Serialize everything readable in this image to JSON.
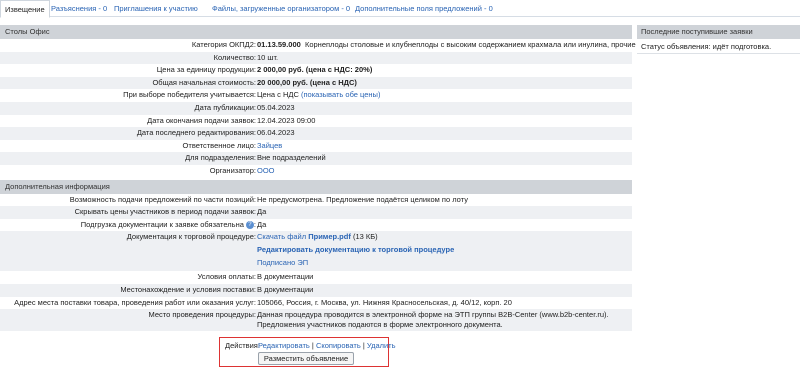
{
  "tabs": [
    {
      "label": "Извещение"
    },
    {
      "label": "Разъяснения - 0"
    },
    {
      "label": "Приглашения к участию"
    },
    {
      "label": "Файлы, загруженные организатором - 0"
    },
    {
      "label": "Дополнительные поля предложений - 0"
    }
  ],
  "main": {
    "section_title": "Столы Офис",
    "rows": [
      {
        "label": "Категория ОКПД2:",
        "code": "01.13.59.000",
        "value": "Корнеплоды столовые и клубнеплоды с высоким содержанием крахмала или инулина, прочие"
      },
      {
        "label": "Количество:",
        "value": "10 шт."
      },
      {
        "label": "Цена за единицу продукции:",
        "value": "2 000,00 руб. (цена с НДС: 20%)"
      },
      {
        "label": "Общая начальная стоимость:",
        "value": "20 000,00 руб. (цена с НДС)"
      },
      {
        "label": "При выборе победителя учитывается:",
        "value": "Цена с НДС",
        "link": "(показывать обе цены)"
      },
      {
        "label": "Дата публикации:",
        "value": "05.04.2023"
      },
      {
        "label": "Дата окончания подачи заявок:",
        "value": "12.04.2023 09:00"
      },
      {
        "label": "Дата последнего редактирования:",
        "value": "06.04.2023"
      },
      {
        "label": "Ответственное лицо:",
        "value": "Зайцев"
      },
      {
        "label": "Для подразделения:",
        "value": "Вне подразделений"
      },
      {
        "label": "Организатор:",
        "value": "ООО"
      }
    ]
  },
  "additional": {
    "section_title": "Дополнительная информация",
    "rows": [
      {
        "label": "Возможность подачи предложений по части позиций:",
        "value": "Не предусмотрена. Предложение подаётся целиком по лоту"
      },
      {
        "label": "Скрывать цены участников в период подачи заявок:",
        "value": "Да"
      },
      {
        "label": "Подгрузка документации к заявке обязательна",
        "value": "Да"
      },
      {
        "label": "Документация к торговой процедуре:",
        "download_prefix": "Скачать файл",
        "file_name": "Пример.pdf",
        "file_size": "(13 КБ)",
        "edit_link": "Редактировать документацию к торговой процедуре",
        "sign_link": "Подписано ЭП"
      },
      {
        "label": "Условия оплаты:",
        "value": "В документации"
      },
      {
        "label": "Местонахождение и условия поставки:",
        "value": "В документации"
      },
      {
        "label": "Адрес места поставки товара, проведения работ или оказания услуг:",
        "value": "105066, Россия, г. Москва, ул. Нижняя Красносельская, д. 40/12, корп. 20"
      },
      {
        "label": "Место проведения процедуры:",
        "value": "Данная процедура проводится в электронной форме на ЭТП группы B2B-Center (www.b2b-center.ru). Предложения участников подаются в форме электронного документа."
      }
    ]
  },
  "actions": {
    "label": "Действия:",
    "edit": "Редактировать",
    "copy": "Скопировать",
    "delete": "Удалить",
    "separator": "|",
    "publish_button": "Разместить объявление"
  },
  "sidebar": {
    "title": "Последние поступившие заявки",
    "status": "Статус объявления: идёт подготовка."
  },
  "colors": {
    "link": "#2a64b4",
    "section_header_bg": "#cfd3d8",
    "highlight_border": "#dd3333"
  }
}
